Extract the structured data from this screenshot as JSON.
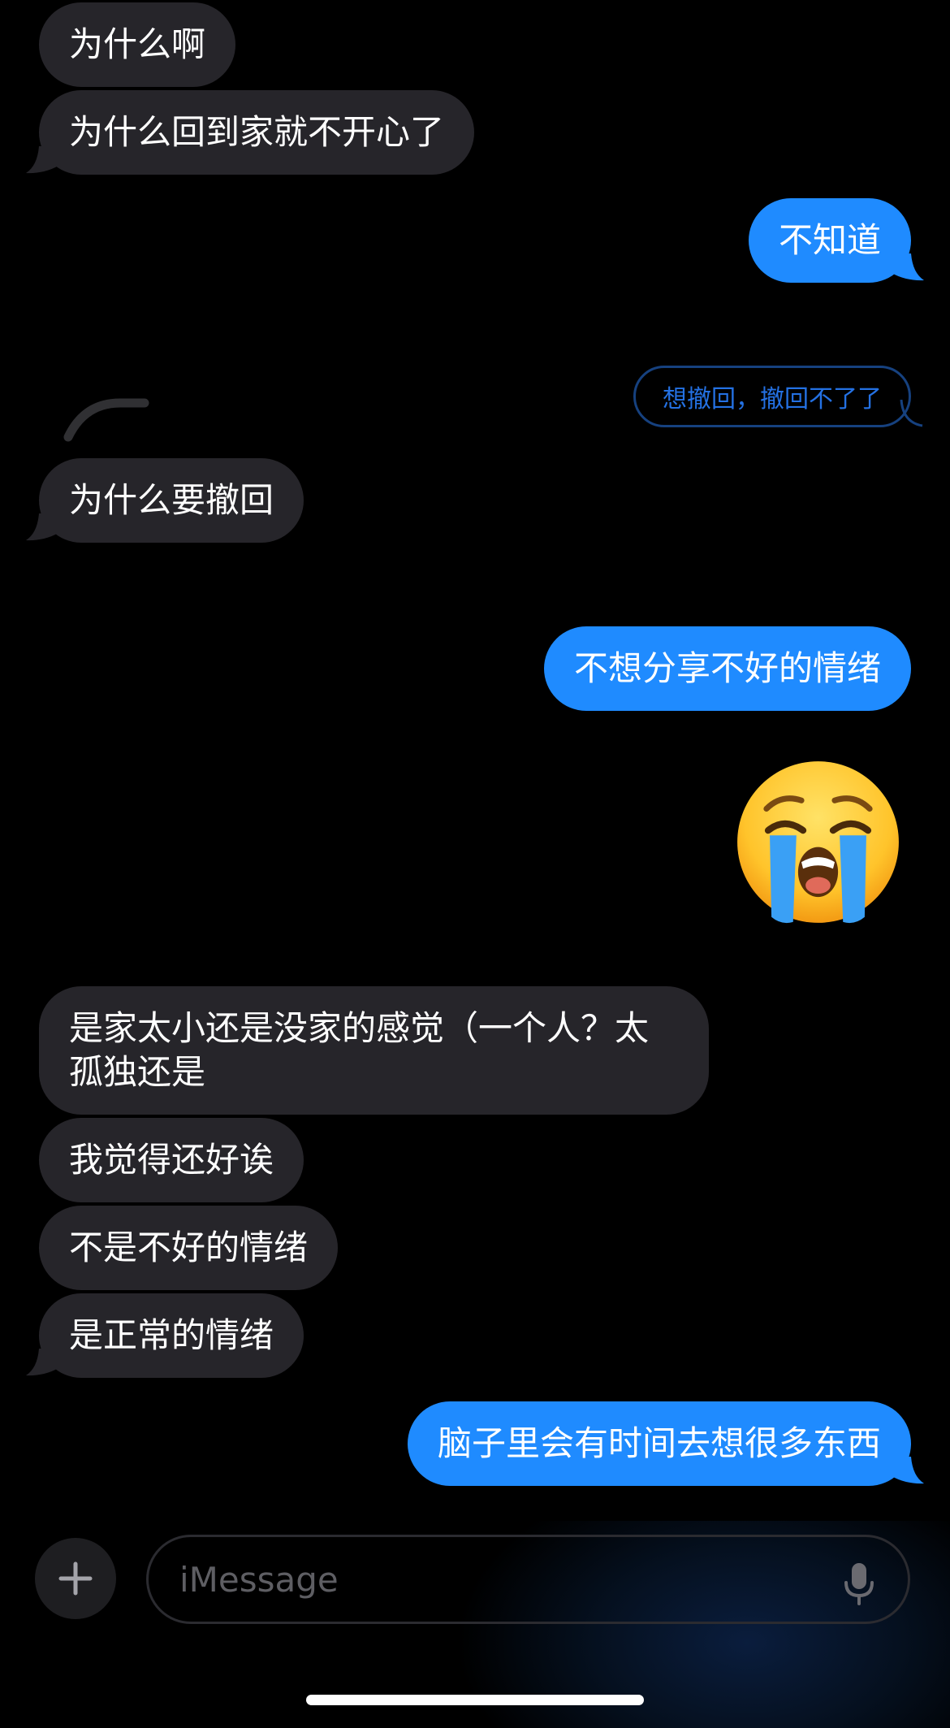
{
  "messages": [
    {
      "side": "in",
      "text": "为什么啊"
    },
    {
      "side": "in",
      "text": "为什么回到家就不开心了"
    },
    {
      "side": "out",
      "text": "不知道"
    },
    {
      "side": "out",
      "text": "想撤回，撤回不了了",
      "style": "unsent"
    },
    {
      "side": "in",
      "text": "为什么要撤回"
    },
    {
      "side": "out",
      "text": "不想分享不好的情绪"
    },
    {
      "side": "out",
      "emoji": "loudly-crying-face"
    },
    {
      "side": "in",
      "text": "是家太小还是没家的感觉（一个人？太孤独还是"
    },
    {
      "side": "in",
      "text": "我觉得还好诶"
    },
    {
      "side": "in",
      "text": "不是不好的情绪"
    },
    {
      "side": "in",
      "text": "是正常的情绪"
    },
    {
      "side": "out",
      "text": "脑子里会有时间去想很多东西"
    }
  ],
  "composer": {
    "placeholder": "iMessage"
  },
  "colors": {
    "incoming": "#26252a",
    "outgoing": "#1f8bff",
    "background": "#000000"
  },
  "icons": [
    "plus-icon",
    "microphone-icon",
    "loudly-crying-face-emoji"
  ]
}
